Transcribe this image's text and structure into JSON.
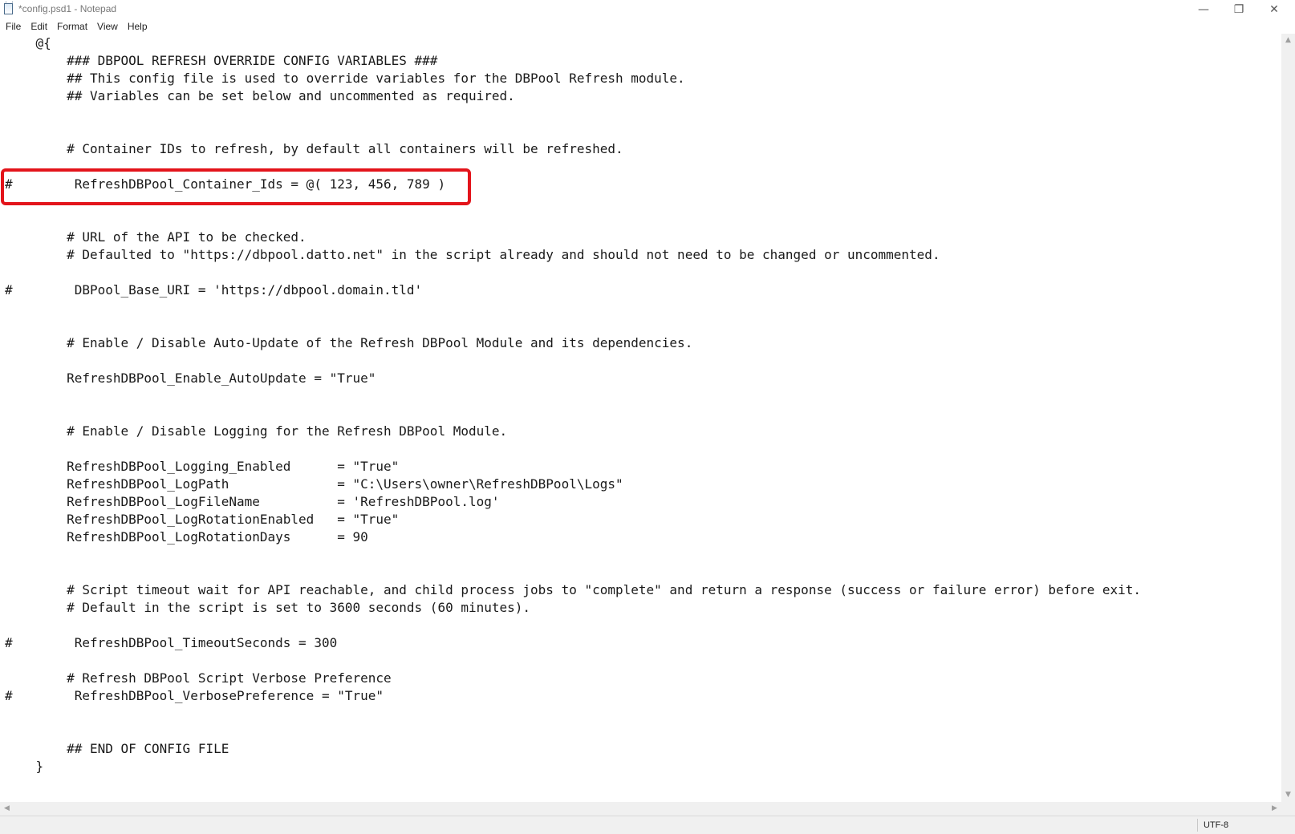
{
  "window": {
    "title": "*config.psd1 - Notepad",
    "controls": {
      "minimize": "—",
      "maximize": "❐",
      "close": "✕"
    }
  },
  "menu": {
    "items": [
      "File",
      "Edit",
      "Format",
      "View",
      "Help"
    ]
  },
  "editor": {
    "lines": [
      "    @{",
      "        ### DBPOOL REFRESH OVERRIDE CONFIG VARIABLES ###",
      "        ## This config file is used to override variables for the DBPool Refresh module.",
      "        ## Variables can be set below and uncommented as required.",
      "",
      "",
      "        # Container IDs to refresh, by default all containers will be refreshed.",
      "",
      "#        RefreshDBPool_Container_Ids = @( 123, 456, 789 )",
      "",
      "",
      "        # URL of the API to be checked.",
      "        # Defaulted to \"https://dbpool.datto.net\" in the script already and should not need to be changed or uncommented.",
      "",
      "#        DBPool_Base_URI = 'https://dbpool.domain.tld'",
      "",
      "",
      "        # Enable / Disable Auto-Update of the Refresh DBPool Module and its dependencies.",
      "",
      "        RefreshDBPool_Enable_AutoUpdate = \"True\"",
      "",
      "",
      "        # Enable / Disable Logging for the Refresh DBPool Module.",
      "",
      "        RefreshDBPool_Logging_Enabled      = \"True\"",
      "        RefreshDBPool_LogPath              = \"C:\\Users\\owner\\RefreshDBPool\\Logs\"",
      "        RefreshDBPool_LogFileName          = 'RefreshDBPool.log'",
      "        RefreshDBPool_LogRotationEnabled   = \"True\"",
      "        RefreshDBPool_LogRotationDays      = 90",
      "",
      "",
      "        # Script timeout wait for API reachable, and child process jobs to \"complete\" and return a response (success or failure error) before exit.",
      "        # Default in the script is set to 3600 seconds (60 minutes).",
      "",
      "#        RefreshDBPool_TimeoutSeconds = 300",
      "",
      "        # Refresh DBPool Script Verbose Preference",
      "#        RefreshDBPool_VerbosePreference = \"True\"",
      "",
      "",
      "        ## END OF CONFIG FILE",
      "    }"
    ]
  },
  "status": {
    "encoding": "UTF-8"
  },
  "colors": {
    "highlight_border": "#e3141b",
    "status_background": "#f0f0f0"
  }
}
